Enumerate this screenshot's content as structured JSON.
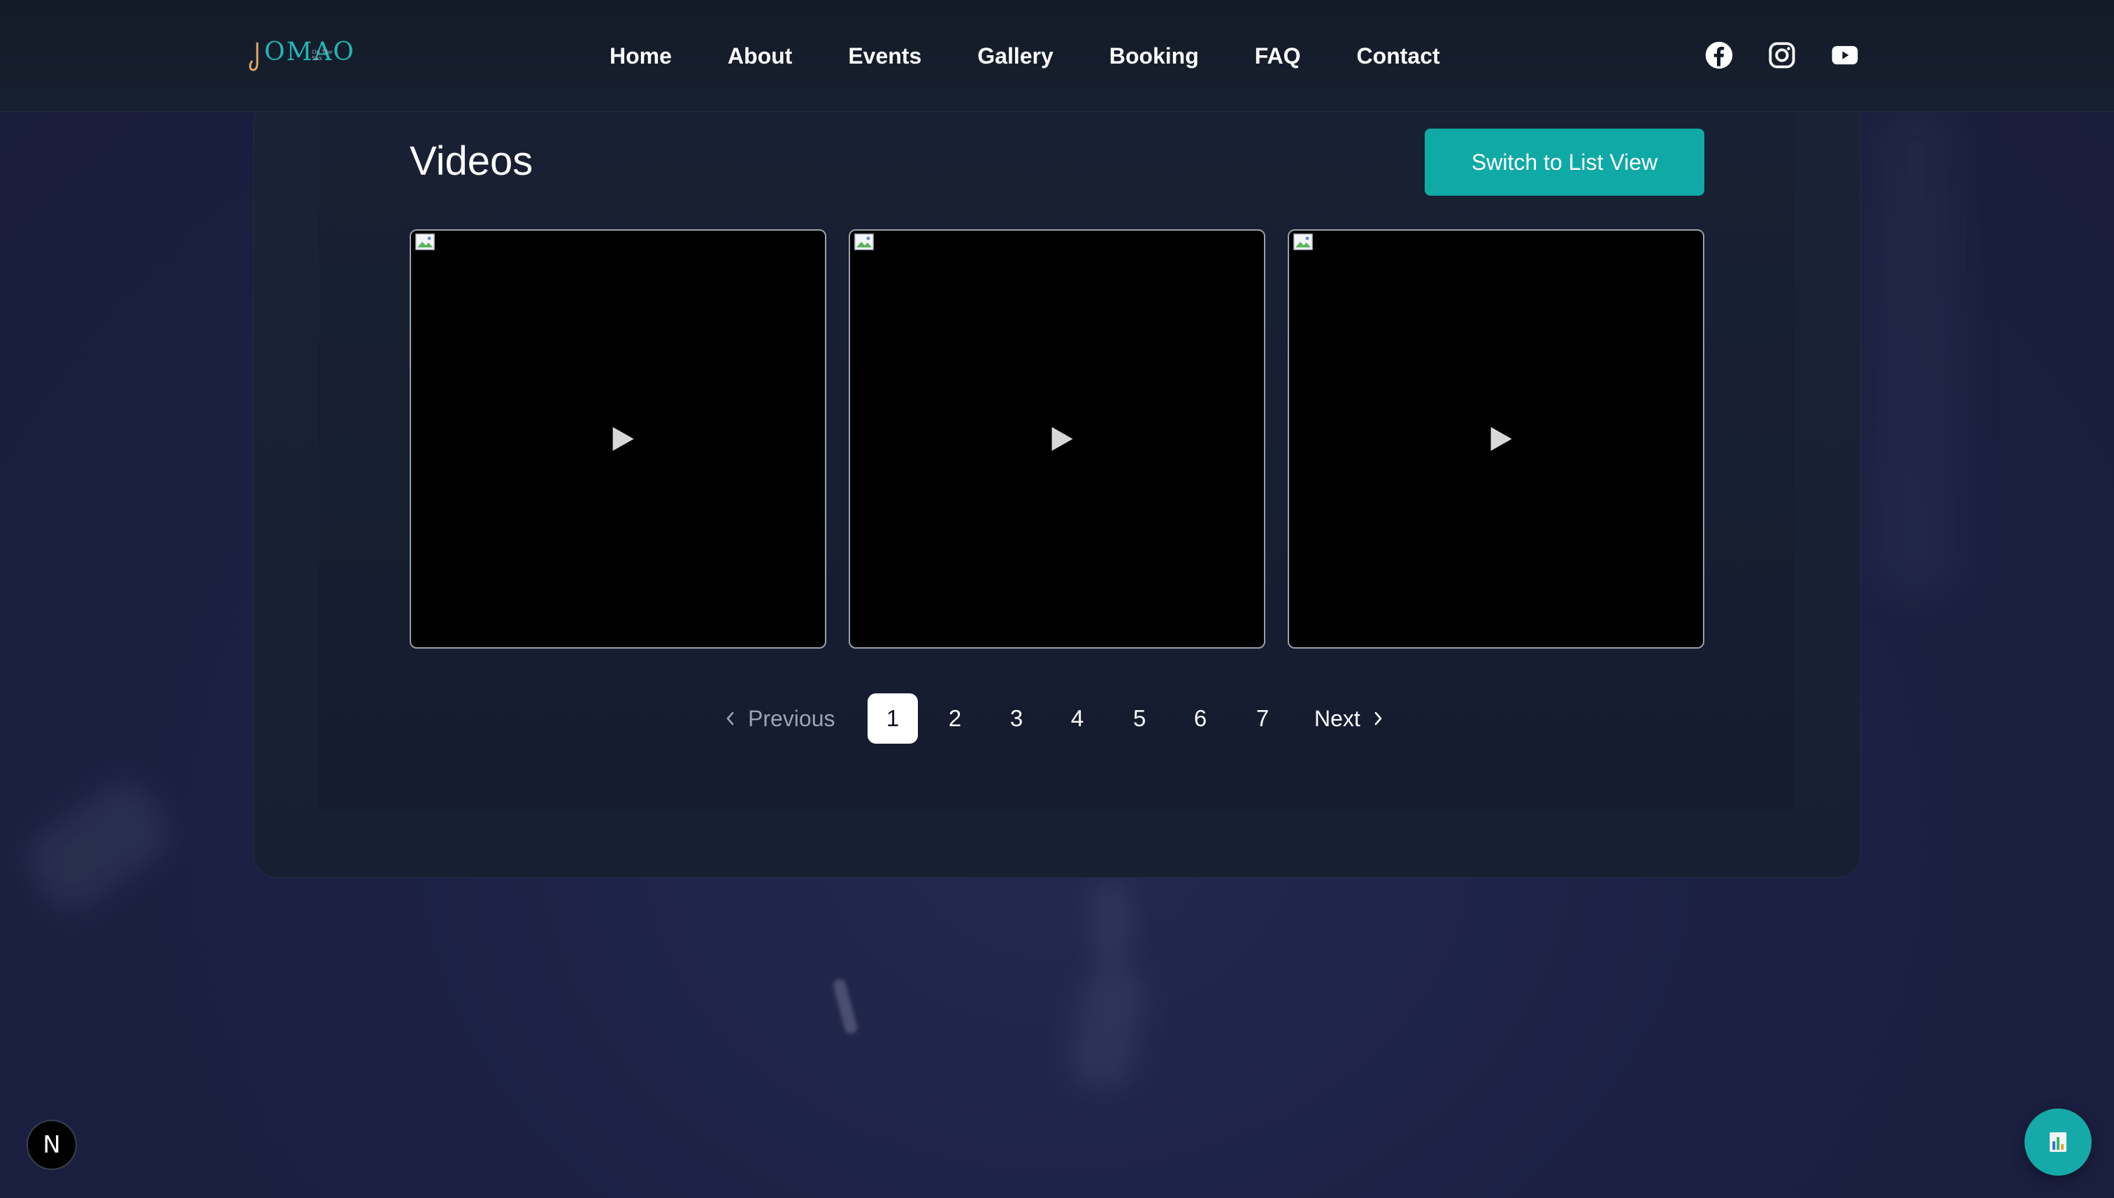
{
  "header": {
    "logo": {
      "text": "OMAO",
      "small_text": "On The Sax",
      "accent_color": "#1fb8b5"
    },
    "nav": [
      {
        "label": "Home"
      },
      {
        "label": "About"
      },
      {
        "label": "Events"
      },
      {
        "label": "Gallery"
      },
      {
        "label": "Booking"
      },
      {
        "label": "FAQ"
      },
      {
        "label": "Contact"
      }
    ],
    "socials": [
      {
        "icon": "facebook-icon"
      },
      {
        "icon": "instagram-icon"
      },
      {
        "icon": "youtube-icon"
      }
    ]
  },
  "main": {
    "title": "Videos",
    "switch_button_label": "Switch to List View",
    "accent_color": "#0fa9a6",
    "videos": [
      {
        "icon": "play-icon",
        "thumbnail": "broken-image-icon"
      },
      {
        "icon": "play-icon",
        "thumbnail": "broken-image-icon"
      },
      {
        "icon": "play-icon",
        "thumbnail": "broken-image-icon"
      }
    ]
  },
  "pagination": {
    "previous_label": "Previous",
    "next_label": "Next",
    "pages": [
      "1",
      "2",
      "3",
      "4",
      "5",
      "6",
      "7"
    ],
    "current_page": "1"
  },
  "badges": {
    "dev_badge_letter": "N",
    "fab_icon": "chart-icon"
  }
}
